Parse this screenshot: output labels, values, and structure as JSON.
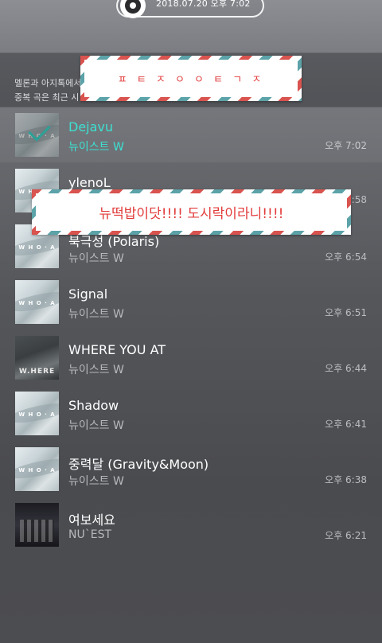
{
  "status": {
    "timestamp": "2018.07.20 오후 7:02"
  },
  "notice": {
    "line1": "멜론과 아지톡에서",
    "line2": "중복 곡은 최근 시"
  },
  "stickers": {
    "top_text": "ㅍ ㅌ ㅈ ㅇ  ㅇ ㅌ ㄱ ㅈ",
    "middle_text": "뉴떡밥이닷!!!! 도시락이라니!!!!"
  },
  "songs": [
    {
      "title": "Dejavu",
      "artist": "뉴이스트 W",
      "time": "오후 7:02",
      "current": true
    },
    {
      "title": "ylenoL",
      "artist": "",
      "time": "6:58",
      "current": false
    },
    {
      "title": "북극성 (Polaris)",
      "artist": "뉴이스트 W",
      "time": "오후 6:54",
      "current": false
    },
    {
      "title": "Signal",
      "artist": "뉴이스트 W",
      "time": "오후 6:51",
      "current": false
    },
    {
      "title": "WHERE YOU AT",
      "artist": "뉴이스트 W",
      "time": "오후 6:44",
      "current": false
    },
    {
      "title": "Shadow",
      "artist": "뉴이스트 W",
      "time": "오후 6:41",
      "current": false
    },
    {
      "title": "중력달 (Gravity&Moon)",
      "artist": "뉴이스트 W",
      "time": "오후 6:38",
      "current": false
    },
    {
      "title": "여보세요",
      "artist": "NU`EST",
      "time": "오후 6:21",
      "current": false
    }
  ],
  "album_art_text": {
    "wanda": "W H O · A",
    "where": "W.HERE"
  },
  "colors": {
    "accent": "#3de0d2",
    "sticker_red": "#d9534f",
    "sticker_teal": "#5ba3a8",
    "sticker_text": "#e23b3b"
  }
}
